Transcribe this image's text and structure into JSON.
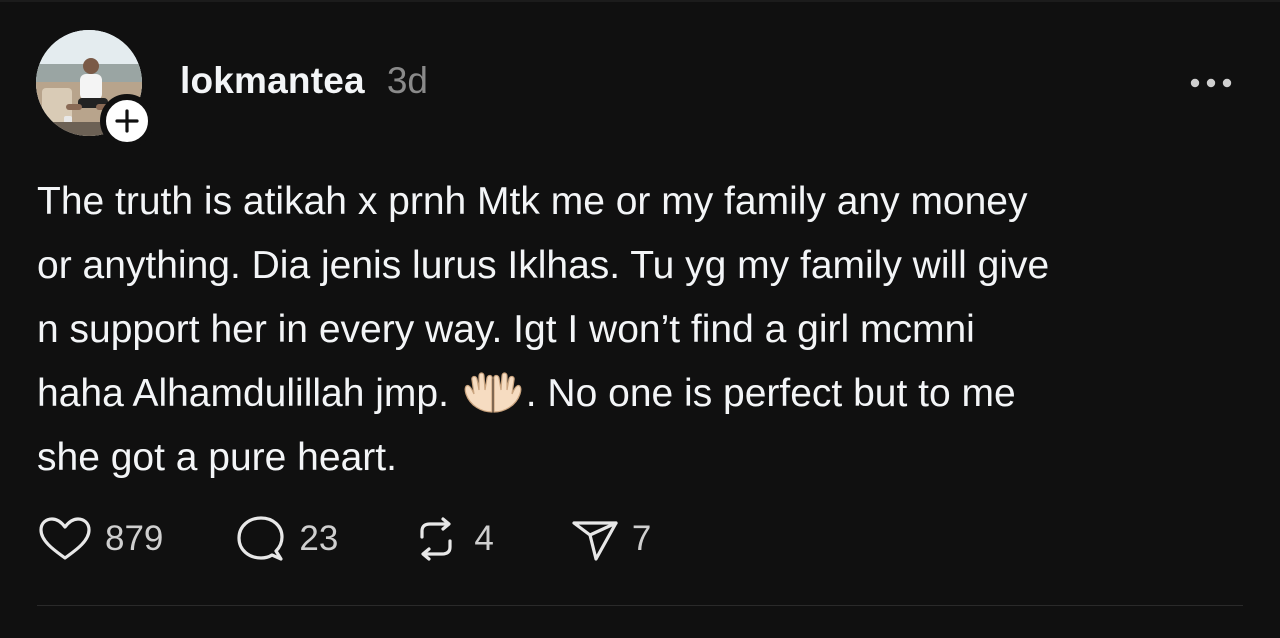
{
  "post": {
    "username": "lokmantea",
    "timestamp": "3d",
    "text_lines": {
      "l1": "The truth is atikah x prnh Mtk me or my family any money",
      "l2": "or anything. Dia jenis lurus Iklhas. Tu yg my family will give",
      "l3": "n support her in every way. Igt I won’t find a girl mcmni",
      "l4a": "haha Alhamdulillah jmp.",
      "l4b": ". No one is perfect but to me",
      "l5": "she got a pure heart."
    },
    "emoji": "palms-up-together",
    "stats": {
      "likes": "879",
      "replies": "23",
      "reposts": "4",
      "shares": "7"
    }
  },
  "icons": {
    "follow": "plus-icon",
    "more": "more-horizontal-icon",
    "like": "heart-icon",
    "reply": "comment-bubble-icon",
    "repost": "repost-icon",
    "share": "send-icon"
  },
  "colors": {
    "background": "#101010",
    "text_primary": "#f3f5f7",
    "text_secondary": "#8a8a8a",
    "divider": "#2a2a2a"
  }
}
